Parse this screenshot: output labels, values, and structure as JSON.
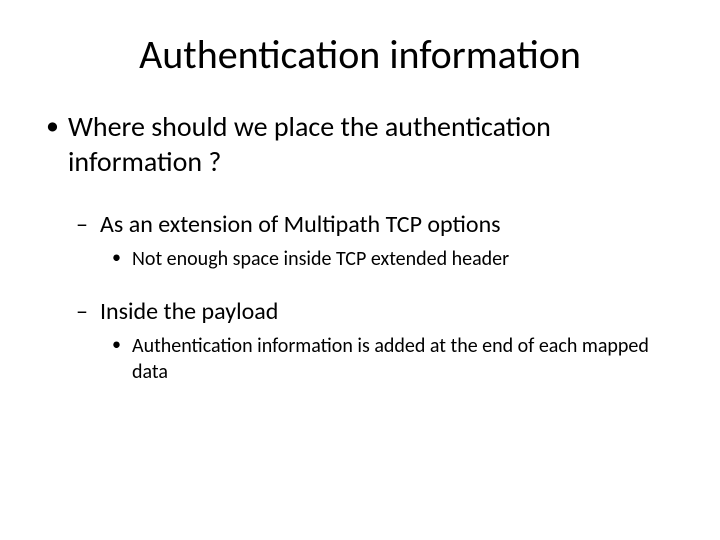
{
  "title": "Authentication information",
  "bullets": {
    "q": "Where should we place the authentication information ?",
    "opt1": "As an extension of Multipath TCP options",
    "opt1_sub": "Not enough space inside TCP extended header",
    "opt2": "Inside the payload",
    "opt2_sub": "Authentication information is added at the end of each mapped data"
  }
}
